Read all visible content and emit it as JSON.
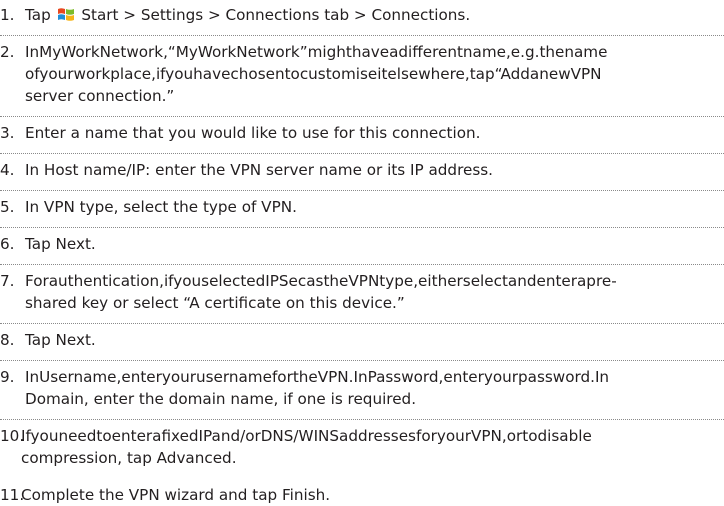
{
  "logo_colors": {
    "red": "#e8471f",
    "green": "#7cbb2a",
    "blue": "#1f8ed8",
    "yellow": "#f6b417",
    "icon": "windows-start-logo-icon"
  },
  "steps": [
    {
      "number": "1.",
      "lines": [
        "Start > Settings > Connections tab > Connections."
      ],
      "prefix": "Tap "
    },
    {
      "number": "2.",
      "lines": [
        "InMyWorkNetwork,“MyWorkNetwork”mighthaveadifferentname,e.g.thename",
        "ofyourworkplace,ifyouhavechosentocustomiseitelsewhere,tap“AddanewVPN",
        "server connection.”"
      ]
    },
    {
      "number": "3.",
      "lines": [
        "Enter a name that you would like to use for this connection."
      ]
    },
    {
      "number": "4.",
      "lines": [
        "In Host name/IP: enter the VPN server name or its IP address."
      ]
    },
    {
      "number": "5.",
      "lines": [
        "In VPN type, select the type of VPN."
      ]
    },
    {
      "number": "6.",
      "lines": [
        "Tap Next."
      ]
    },
    {
      "number": "7.",
      "lines": [
        "Forauthentication,ifyouselectedIPSecastheVPNtype,eitherselectandenterapre-",
        "shared key or select “A certificate on this device.”"
      ]
    },
    {
      "number": "8.",
      "lines": [
        "Tap Next."
      ]
    },
    {
      "number": "9.",
      "lines": [
        "InUsername,enteryourusernamefortheVPN.InPassword,enteryourpassword.In",
        "Domain, enter the domain name, if one is required."
      ]
    },
    {
      "number": "10.",
      "lines": [
        "IfyouneedtoenterafixedIPand/orDNS/WINSaddressesforyourVPN,ortodisable",
        "compression, tap Advanced."
      ]
    },
    {
      "number": "11.",
      "lines": [
        "Complete the VPN wizard and tap Finish."
      ]
    }
  ]
}
